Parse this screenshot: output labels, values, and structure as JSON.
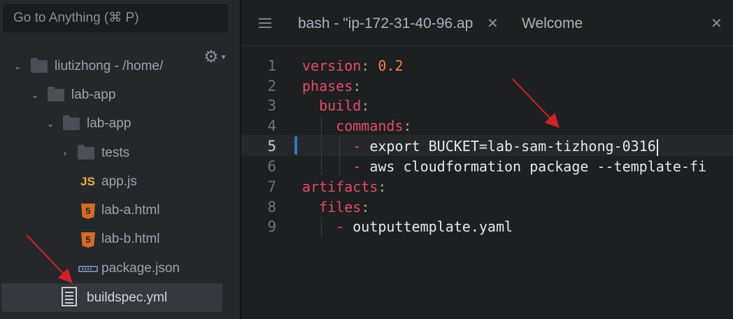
{
  "sidebar": {
    "goto_placeholder": "Go to Anything (⌘ P)",
    "tree": {
      "root_name": "liutizhong",
      "root_path": " - /home/",
      "folder1": "lab-app",
      "folder2": "lab-app",
      "folder3": "tests",
      "files": [
        "app.js",
        "lab-a.html",
        "lab-b.html",
        "package.json",
        "buildspec.yml"
      ],
      "js_badge": "JS",
      "html_badge": "5"
    }
  },
  "tabs": [
    {
      "label": "bash - \"ip-172-31-40-96.ap"
    },
    {
      "label": "Welcome"
    }
  ],
  "editor": {
    "line_numbers": [
      "1",
      "2",
      "3",
      "4",
      "5",
      "6",
      "7",
      "8",
      "9"
    ],
    "lines": [
      {
        "key": "version",
        "colon": ":",
        "value": " 0.2"
      },
      {
        "key": "phases",
        "colon": ":"
      },
      {
        "indent": "  ",
        "key": "build",
        "colon": ":"
      },
      {
        "indent": "    ",
        "key": "commands",
        "colon": ":"
      },
      {
        "indent": "      ",
        "dash": "-",
        "text": " export BUCKET=lab-sam-tizhong-0316"
      },
      {
        "indent": "      ",
        "dash": "-",
        "text": " aws cloudformation package --template-fi"
      },
      {
        "key": "artifacts",
        "colon": ":"
      },
      {
        "indent": "  ",
        "key": "files",
        "colon": ":"
      },
      {
        "indent": "    ",
        "dash": "-",
        "text": " outputtemplate.yaml"
      }
    ]
  },
  "icons": {
    "gear": "gear-icon",
    "menu": "hamburger-icon",
    "close": "close-icon"
  },
  "colors": {
    "key": "#e04c6a",
    "number": "#f0834a",
    "punctuation": "#8ec07c",
    "arrow": "#d0202a",
    "modified_marker": "#2e7bb6"
  }
}
